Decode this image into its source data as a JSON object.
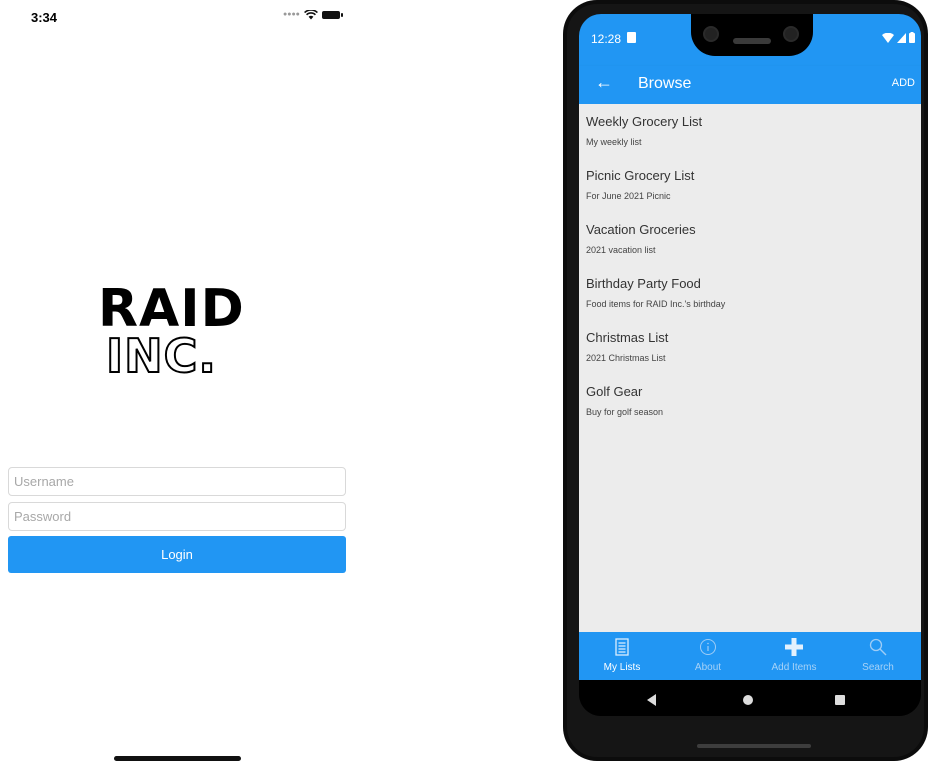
{
  "ios": {
    "status": {
      "time": "3:34"
    },
    "logo": {
      "line1": "RAID",
      "line2": "INC."
    },
    "login": {
      "username_placeholder": "Username",
      "password_placeholder": "Password",
      "button_label": "Login"
    }
  },
  "android": {
    "status": {
      "time": "12:28"
    },
    "toolbar": {
      "title": "Browse",
      "action": "ADD"
    },
    "items": [
      {
        "title": "Weekly Grocery List",
        "subtitle": "My weekly list"
      },
      {
        "title": "Picnic Grocery List",
        "subtitle": "For June 2021 Picnic"
      },
      {
        "title": "Vacation Groceries",
        "subtitle": "2021 vacation list"
      },
      {
        "title": "Birthday Party Food",
        "subtitle": "Food items for RAID Inc.'s birthday"
      },
      {
        "title": "Christmas List",
        "subtitle": "2021 Christmas List"
      },
      {
        "title": "Golf Gear",
        "subtitle": "Buy for golf season"
      }
    ],
    "tabs": [
      {
        "label": "My Lists",
        "icon": "list-icon",
        "active": true
      },
      {
        "label": "About",
        "icon": "info-icon",
        "active": false
      },
      {
        "label": "Add Items",
        "icon": "plus-icon",
        "active": false
      },
      {
        "label": "Search",
        "icon": "search-icon",
        "active": false
      }
    ]
  },
  "colors": {
    "accent": "#2196f3",
    "list_background": "#ececec",
    "tab_inactive_text": "#a7d2f7"
  }
}
